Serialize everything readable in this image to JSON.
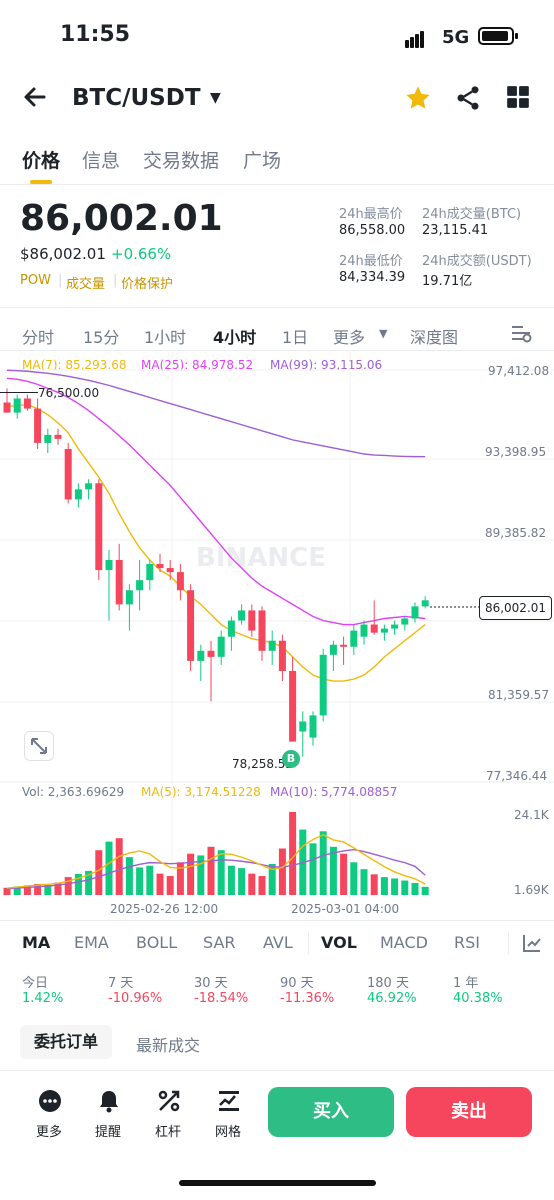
{
  "status_bar": {
    "time": "11:55",
    "network": "5G"
  },
  "header": {
    "pair": "BTC/USDT"
  },
  "tabs": [
    {
      "label": "价格",
      "active": true
    },
    {
      "label": "信息",
      "active": false
    },
    {
      "label": "交易数据",
      "active": false
    },
    {
      "label": "广场",
      "active": false
    }
  ],
  "price": {
    "last": "86,002.01",
    "usd": "$86,002.01",
    "change": "+0.66%",
    "tags": [
      "POW",
      "成交量",
      "价格保护"
    ]
  },
  "stats": {
    "high_label": "24h最高价",
    "high": "86,558.00",
    "vol_btc_label": "24h成交量(BTC)",
    "vol_btc": "23,115.41",
    "low_label": "24h最低价",
    "low": "84,334.39",
    "vol_usdt_label": "24h成交额(USDT)",
    "vol_usdt": "19.71亿"
  },
  "intervals": [
    {
      "label": "分时",
      "active": false
    },
    {
      "label": "15分",
      "active": false
    },
    {
      "label": "1小时",
      "active": false
    },
    {
      "label": "4小时",
      "active": true
    },
    {
      "label": "1日",
      "active": false
    },
    {
      "label": "更多",
      "active": false
    },
    {
      "label": "深度图",
      "active": false
    }
  ],
  "ma_legend": {
    "ma7": "MA(7): 85,293.68",
    "ma25": "MA(25): 84,978.52",
    "ma99": "MA(99): 93,115.06"
  },
  "price_axis": [
    "97,412.08",
    "93,398.95",
    "89,385.82",
    "81,359.57",
    "77,346.44"
  ],
  "current_price_tag": "86,002.01",
  "high_marker": "76,500.00",
  "low_marker": "78,258.52",
  "buy_marker": "B",
  "watermark": "BINANCE",
  "vol_legend": {
    "vol": "Vol: 2,363.69629",
    "ma5": "MA(5): 3,174.51228",
    "ma10": "MA(10): 5,774.08857"
  },
  "vol_axis": [
    "24.1K",
    "1.69K"
  ],
  "date_labels": [
    "2025-02-26 12:00",
    "2025-03-01 04:00"
  ],
  "indicators": [
    {
      "label": "MA",
      "active": true
    },
    {
      "label": "EMA",
      "active": false
    },
    {
      "label": "BOLL",
      "active": false
    },
    {
      "label": "SAR",
      "active": false
    },
    {
      "label": "AVL",
      "active": false
    },
    {
      "label": "VOL",
      "active": true
    },
    {
      "label": "MACD",
      "active": false
    },
    {
      "label": "RSI",
      "active": false
    }
  ],
  "performance": [
    {
      "label": "今日",
      "value": "1.42%",
      "color": "#0ecb81"
    },
    {
      "label": "7 天",
      "value": "-10.96%",
      "color": "#f6465d"
    },
    {
      "label": "30 天",
      "value": "-18.54%",
      "color": "#f6465d"
    },
    {
      "label": "90 天",
      "value": "-11.36%",
      "color": "#f6465d"
    },
    {
      "label": "180 天",
      "value": "46.92%",
      "color": "#0ecb81"
    },
    {
      "label": "1 年",
      "value": "40.38%",
      "color": "#0ecb81"
    }
  ],
  "order_tabs": {
    "orders": "委托订单",
    "trades": "最新成交"
  },
  "bottom_bar": {
    "more": "更多",
    "alert": "提醒",
    "leverage": "杠杆",
    "grid": "网格",
    "buy": "买入",
    "sell": "卖出"
  },
  "colors": {
    "up": "#0ecb81",
    "down": "#f6465d",
    "accent": "#f0b90b",
    "ma7": "#f0b90b",
    "ma25": "#e040fb",
    "ma99": "#9c5fd6"
  },
  "chart_data": {
    "type": "candlestick",
    "interval": "4h",
    "ylim": [
      77346.44,
      97412.08
    ],
    "candles": [
      {
        "o": 95800,
        "h": 96500,
        "l": 95300,
        "c": 95300
      },
      {
        "o": 95300,
        "h": 96200,
        "l": 95000,
        "c": 96000
      },
      {
        "o": 96000,
        "h": 96200,
        "l": 95400,
        "c": 95500
      },
      {
        "o": 95500,
        "h": 96000,
        "l": 93500,
        "c": 93800
      },
      {
        "o": 93800,
        "h": 94500,
        "l": 93300,
        "c": 94200
      },
      {
        "o": 94200,
        "h": 94500,
        "l": 93700,
        "c": 94000
      },
      {
        "o": 93500,
        "h": 93800,
        "l": 90800,
        "c": 91000
      },
      {
        "o": 91000,
        "h": 91800,
        "l": 90600,
        "c": 91500
      },
      {
        "o": 91500,
        "h": 92000,
        "l": 91000,
        "c": 91800
      },
      {
        "o": 91800,
        "h": 92000,
        "l": 87000,
        "c": 87500
      },
      {
        "o": 87500,
        "h": 88500,
        "l": 85000,
        "c": 88000
      },
      {
        "o": 88000,
        "h": 88800,
        "l": 85500,
        "c": 85800
      },
      {
        "o": 85800,
        "h": 86800,
        "l": 84500,
        "c": 86500
      },
      {
        "o": 86500,
        "h": 88000,
        "l": 85500,
        "c": 87000
      },
      {
        "o": 87000,
        "h": 88000,
        "l": 86500,
        "c": 87800
      },
      {
        "o": 87800,
        "h": 88300,
        "l": 87400,
        "c": 87600
      },
      {
        "o": 87600,
        "h": 88000,
        "l": 87000,
        "c": 87400
      },
      {
        "o": 87400,
        "h": 87800,
        "l": 86000,
        "c": 86500
      },
      {
        "o": 86500,
        "h": 86800,
        "l": 82500,
        "c": 83000
      },
      {
        "o": 83000,
        "h": 83800,
        "l": 82000,
        "c": 83500
      },
      {
        "o": 83500,
        "h": 84000,
        "l": 81000,
        "c": 83200
      },
      {
        "o": 83200,
        "h": 84500,
        "l": 82800,
        "c": 84200
      },
      {
        "o": 84200,
        "h": 85200,
        "l": 83500,
        "c": 85000
      },
      {
        "o": 85000,
        "h": 85800,
        "l": 84800,
        "c": 85500
      },
      {
        "o": 85500,
        "h": 85800,
        "l": 84200,
        "c": 84500
      },
      {
        "o": 85500,
        "h": 85700,
        "l": 83000,
        "c": 83500
      },
      {
        "o": 83500,
        "h": 84500,
        "l": 82800,
        "c": 84000
      },
      {
        "o": 84000,
        "h": 84300,
        "l": 82000,
        "c": 82500
      },
      {
        "o": 82500,
        "h": 83200,
        "l": 79000,
        "c": 79000
      },
      {
        "o": 79500,
        "h": 80500,
        "l": 78258.52,
        "c": 80000
      },
      {
        "o": 79200,
        "h": 80500,
        "l": 78800,
        "c": 80300
      },
      {
        "o": 80300,
        "h": 83600,
        "l": 80000,
        "c": 83300
      },
      {
        "o": 83300,
        "h": 84000,
        "l": 82500,
        "c": 83800
      },
      {
        "o": 83800,
        "h": 84200,
        "l": 82800,
        "c": 83700
      },
      {
        "o": 83700,
        "h": 84800,
        "l": 83300,
        "c": 84500
      },
      {
        "o": 84200,
        "h": 85000,
        "l": 83800,
        "c": 84800
      },
      {
        "o": 84800,
        "h": 86000,
        "l": 84300,
        "c": 84400
      },
      {
        "o": 84400,
        "h": 84800,
        "l": 84000,
        "c": 84600
      },
      {
        "o": 84600,
        "h": 85000,
        "l": 84300,
        "c": 84800
      },
      {
        "o": 84800,
        "h": 85200,
        "l": 84500,
        "c": 85100
      },
      {
        "o": 85100,
        "h": 85900,
        "l": 84900,
        "c": 85700
      },
      {
        "o": 85700,
        "h": 86200,
        "l": 85600,
        "c": 86000
      }
    ],
    "ma7": [
      95600,
      95650,
      95700,
      95500,
      95200,
      94800,
      94300,
      93500,
      92800,
      92100,
      91300,
      90300,
      89400,
      88600,
      88000,
      87500,
      87200,
      86700,
      86200,
      85800,
      85300,
      84800,
      84500,
      84300,
      84100,
      84000,
      83900,
      83700,
      83200,
      82700,
      82300,
      82100,
      82000,
      82000,
      82100,
      82300,
      82700,
      83200,
      83600,
      84000,
      84400,
      84800
    ],
    "ma25": [
      97000,
      96950,
      96850,
      96700,
      96500,
      96300,
      96050,
      95750,
      95400,
      95000,
      94600,
      94150,
      93700,
      93200,
      92700,
      92200,
      91700,
      91100,
      90500,
      89900,
      89300,
      88700,
      88100,
      87600,
      87100,
      86700,
      86400,
      86100,
      85800,
      85500,
      85200,
      85000,
      84900,
      84800,
      84800,
      84900,
      85000,
      85100,
      85150,
      85200,
      85150,
      85100
    ],
    "ma99": [
      97400,
      97380,
      97350,
      97300,
      97250,
      97180,
      97100,
      97000,
      96900,
      96780,
      96650,
      96500,
      96350,
      96200,
      96050,
      95900,
      95750,
      95600,
      95450,
      95300,
      95150,
      95000,
      94850,
      94700,
      94550,
      94400,
      94250,
      94100,
      93950,
      93850,
      93750,
      93650,
      93550,
      93450,
      93350,
      93250,
      93200,
      93180,
      93150,
      93130,
      93120,
      93115
    ],
    "volume": [
      2100,
      2500,
      2800,
      3200,
      2900,
      3600,
      5200,
      6100,
      7000,
      13000,
      15500,
      16500,
      11000,
      8000,
      8500,
      6200,
      5500,
      9500,
      12000,
      11500,
      14000,
      13000,
      8500,
      7800,
      6200,
      5500,
      9000,
      13500,
      24100,
      19000,
      15000,
      18500,
      14000,
      12000,
      9500,
      7500,
      6000,
      5200,
      4800,
      4200,
      3500,
      2363.69629
    ],
    "vol_ma5": [
      2000,
      2300,
      2600,
      2900,
      3100,
      3400,
      4000,
      4900,
      5800,
      7200,
      9200,
      11200,
      12200,
      12800,
      11900,
      9700,
      8000,
      7800,
      8300,
      9100,
      10500,
      12000,
      11800,
      11000,
      9900,
      8600,
      7400,
      8000,
      10800,
      14200,
      16100,
      17500,
      16000,
      15400,
      13700,
      11800,
      10000,
      8200,
      6700,
      5600,
      4700,
      3174.51228
    ],
    "vol_ma10": [
      1800,
      2000,
      2200,
      2400,
      2600,
      2900,
      3300,
      3800,
      4400,
      5300,
      6300,
      7400,
      8200,
      8900,
      9400,
      9300,
      9100,
      9200,
      9500,
      9700,
      9900,
      10200,
      10100,
      9800,
      9400,
      8800,
      8200,
      8100,
      8600,
      9400,
      10300,
      11500,
      12200,
      12800,
      13200,
      12600,
      11800,
      11000,
      10100,
      9400,
      8300,
      5774.08857
    ]
  }
}
